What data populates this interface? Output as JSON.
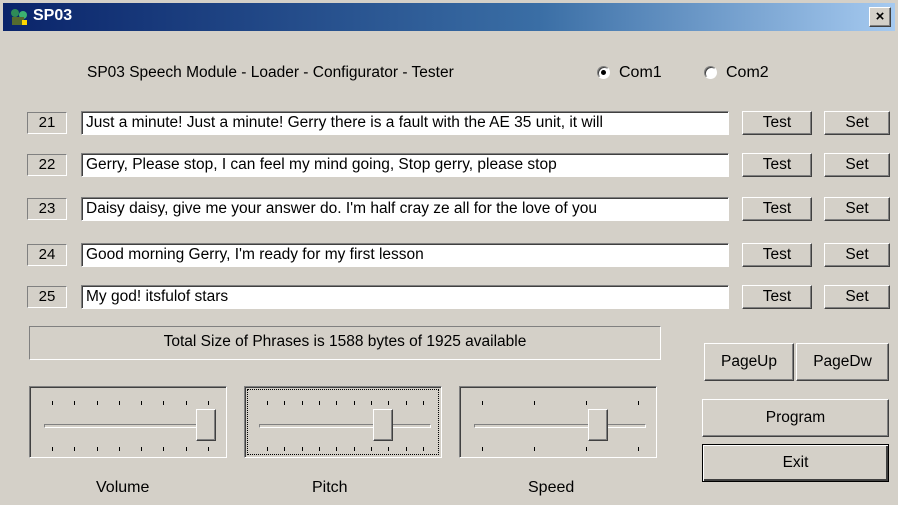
{
  "window": {
    "title": "SP03",
    "close_label": "×"
  },
  "header": {
    "description": "SP03 Speech Module - Loader - Configurator - Tester",
    "com_options": [
      {
        "label": "Com1",
        "selected": true
      },
      {
        "label": "Com2",
        "selected": false
      }
    ]
  },
  "phrases": [
    {
      "number": "21",
      "text": "Just a minute! Just a minute! Gerry there is a fault with the AE 35 unit, it will"
    },
    {
      "number": "22",
      "text": "Gerry, Please stop, I can feel my mind going, Stop gerry, please stop"
    },
    {
      "number": "23",
      "text": "Daisy daisy, give me your answer do. I'm half cray ze all for the love of you"
    },
    {
      "number": "24",
      "text": "Good morning Gerry, I'm ready for my first lesson"
    },
    {
      "number": "25",
      "text": "My god! itsfulof stars"
    }
  ],
  "buttons": {
    "test_label": "Test",
    "set_label": "Set",
    "page_up": "PageUp",
    "page_down": "PageDw",
    "program": "Program",
    "exit": "Exit"
  },
  "status": {
    "text": "Total Size of Phrases is 1588 bytes of 1925 available"
  },
  "sliders": [
    {
      "label": "Volume",
      "value_fraction": 1.0
    },
    {
      "label": "Pitch",
      "value_fraction": 0.75
    },
    {
      "label": "Speed",
      "value_fraction": 0.75
    }
  ],
  "colors": {
    "window_bg": "#d4d0c8",
    "title_start": "#0a246a",
    "title_end": "#a6caf0"
  }
}
